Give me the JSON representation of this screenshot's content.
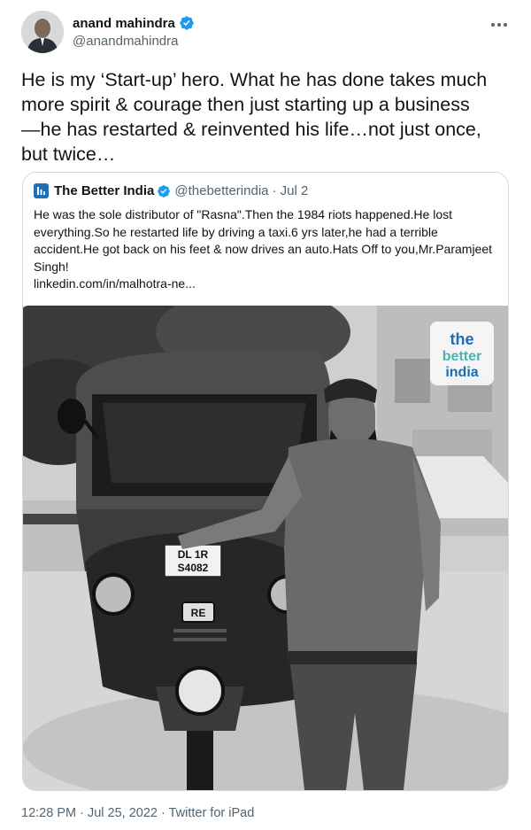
{
  "author": {
    "name": "anand mahindra",
    "handle": "@anandmahindra",
    "verified": true
  },
  "tweet": {
    "text": "He is my ‘Start-up’ hero. What he has done takes much\nmore spirit & courage then just starting up a business\n—he has restarted & reinvented his life…not just once,\nbut twice…"
  },
  "quoted": {
    "name": "The Better India",
    "handle": "@thebetterindia",
    "date": "· Jul 2",
    "text": "He was the sole distributor of \"Rasna\".Then the 1984 riots happened.He lost everything.So he restarted life by driving a taxi.6 yrs later,he had a terrible accident.He got back on his feet & now drives an auto.Hats Off to you,Mr.Paramjeet Singh!",
    "link": "linkedin.com/in/malhotra-ne...",
    "photo": {
      "watermark": [
        "the",
        "better",
        "india"
      ],
      "plate": [
        "DL 1R",
        "S4082"
      ],
      "badge": "RE"
    }
  },
  "footer": {
    "timestamp": "12:28 PM · Jul 25, 2022 · Twitter for iPad"
  },
  "colors": {
    "text": "#0f1419",
    "secondary": "#536471",
    "verified": "#1d9bf0",
    "border": "#cfd9de",
    "brand_watermark": "#1e6db3"
  }
}
